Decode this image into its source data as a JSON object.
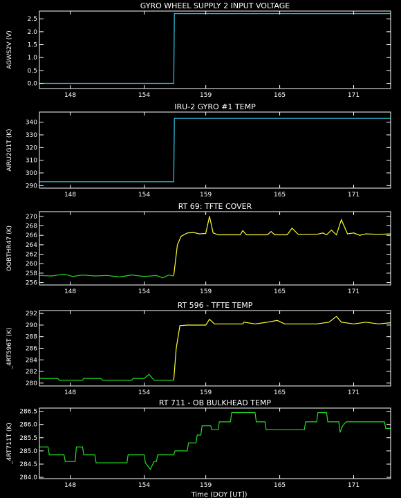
{
  "xlabel": "Time (DOY [UT])",
  "colors": {
    "background": "#000000",
    "axes": "#ffffff",
    "cyan": "#33ccee",
    "yellow": "#ffff33",
    "green": "#22dd22"
  },
  "chart_data": [
    {
      "type": "line",
      "title": "GYRO WHEEL SUPPLY 2 INPUT VOLTAGE",
      "ylabel": "AGWS2V (V)",
      "xlim": [
        145.5,
        174
      ],
      "ylim": [
        -0.2,
        2.8
      ],
      "xticks": [
        148,
        154,
        159,
        165,
        171
      ],
      "xtick_labels": [
        "148",
        "154",
        "159",
        "165",
        "171"
      ],
      "yticks": [
        0.0,
        0.5,
        1.0,
        1.5,
        2.0,
        2.5
      ],
      "ytick_labels": [
        "0.0",
        "0.5",
        "1.0",
        "1.5",
        "2.0",
        "2.5"
      ],
      "series": [
        {
          "color": "cyan",
          "points": [
            [
              145.5,
              0.0
            ],
            [
              156.4,
              0.0
            ],
            [
              156.45,
              2.7
            ],
            [
              174,
              2.7
            ]
          ]
        }
      ]
    },
    {
      "type": "line",
      "title": "IRU-2 GYRO #1 TEMP",
      "ylabel": "AIRU2G1T (K)",
      "xlim": [
        145.5,
        174
      ],
      "ylim": [
        288,
        348
      ],
      "xticks": [
        148,
        154,
        159,
        165,
        171
      ],
      "xtick_labels": [
        "148",
        "154",
        "159",
        "165",
        "171"
      ],
      "yticks": [
        290,
        300,
        310,
        320,
        330,
        340
      ],
      "ytick_labels": [
        "290",
        "300",
        "310",
        "320",
        "330",
        "340"
      ],
      "series": [
        {
          "color": "cyan",
          "points": [
            [
              145.5,
              293
            ],
            [
              156.4,
              293
            ],
            [
              156.45,
              343
            ],
            [
              174,
              343
            ]
          ]
        }
      ]
    },
    {
      "type": "line",
      "title": "RT 69: TFTE COVER",
      "ylabel": "OOBTHR47 (K)",
      "xlim": [
        145.5,
        174
      ],
      "ylim": [
        255.5,
        271
      ],
      "xticks": [
        148,
        154,
        159,
        165,
        171
      ],
      "xtick_labels": [
        "148",
        "154",
        "159",
        "165",
        "171"
      ],
      "yticks": [
        256,
        258,
        260,
        262,
        264,
        266,
        268,
        270
      ],
      "ytick_labels": [
        "256",
        "258",
        "260",
        "262",
        "264",
        "266",
        "268",
        "270"
      ],
      "series": [
        {
          "color": "green",
          "points": [
            [
              145.5,
              257.5
            ],
            [
              146.5,
              257.4
            ],
            [
              147.5,
              257.8
            ],
            [
              148.2,
              257.3
            ],
            [
              149,
              257.6
            ],
            [
              150,
              257.4
            ],
            [
              151,
              257.5
            ],
            [
              152,
              257.2
            ],
            [
              153,
              257.6
            ],
            [
              154,
              257.3
            ],
            [
              155,
              257.5
            ],
            [
              155.5,
              257.0
            ],
            [
              156,
              257.6
            ],
            [
              156.4,
              257.4
            ]
          ]
        },
        {
          "color": "yellow",
          "points": [
            [
              156.4,
              257.5
            ],
            [
              156.7,
              264
            ],
            [
              157,
              265.8
            ],
            [
              157.5,
              266.5
            ],
            [
              158,
              266.6
            ],
            [
              158.5,
              266.3
            ],
            [
              159,
              266.4
            ],
            [
              159.3,
              270.0
            ],
            [
              159.6,
              266.5
            ],
            [
              160,
              266.1
            ],
            [
              161,
              266.1
            ],
            [
              161.8,
              266.1
            ],
            [
              162,
              267.0
            ],
            [
              162.3,
              266.1
            ],
            [
              163,
              266.1
            ],
            [
              164,
              266.1
            ],
            [
              164.3,
              266.8
            ],
            [
              164.6,
              266.1
            ],
            [
              165,
              266.1
            ],
            [
              165.6,
              266.1
            ],
            [
              166,
              267.5
            ],
            [
              166.5,
              266.2
            ],
            [
              167,
              266.2
            ],
            [
              168,
              266.2
            ],
            [
              168.5,
              266.5
            ],
            [
              168.8,
              266.1
            ],
            [
              169.2,
              267.1
            ],
            [
              169.6,
              266.1
            ],
            [
              170,
              269.3
            ],
            [
              170.5,
              266.3
            ],
            [
              171,
              266.5
            ],
            [
              171.5,
              266.0
            ],
            [
              172,
              266.3
            ],
            [
              173,
              266.2
            ],
            [
              174,
              266.3
            ]
          ]
        }
      ]
    },
    {
      "type": "line",
      "title": "RT 596 - TFTE TEMP",
      "ylabel": "_4RT596T (K)",
      "xlim": [
        145.5,
        174
      ],
      "ylim": [
        279.5,
        292.5
      ],
      "xticks": [
        148,
        154,
        159,
        165,
        171
      ],
      "xtick_labels": [
        "148",
        "154",
        "159",
        "165",
        "171"
      ],
      "yticks": [
        280,
        282,
        284,
        286,
        288,
        290,
        292
      ],
      "ytick_labels": [
        "280",
        "282",
        "284",
        "286",
        "288",
        "290",
        "292"
      ],
      "series": [
        {
          "color": "green",
          "points": [
            [
              145.5,
              280.8
            ],
            [
              147,
              280.8
            ],
            [
              147.1,
              280.5
            ],
            [
              149,
              280.5
            ],
            [
              149.1,
              280.8
            ],
            [
              150.5,
              280.8
            ],
            [
              150.6,
              280.5
            ],
            [
              153,
              280.5
            ],
            [
              153.1,
              280.8
            ],
            [
              154,
              280.8
            ],
            [
              154.4,
              281.5
            ],
            [
              154.8,
              280.5
            ],
            [
              156.4,
              280.5
            ]
          ]
        },
        {
          "color": "yellow",
          "points": [
            [
              156.4,
              280.5
            ],
            [
              156.6,
              286
            ],
            [
              156.9,
              289.9
            ],
            [
              157.5,
              290.0
            ],
            [
              158.5,
              290.0
            ],
            [
              159,
              290.0
            ],
            [
              159.3,
              291.0
            ],
            [
              159.7,
              290.2
            ],
            [
              161,
              290.2
            ],
            [
              162,
              290.2
            ],
            [
              162.1,
              290.5
            ],
            [
              163,
              290.2
            ],
            [
              164,
              290.5
            ],
            [
              164.8,
              290.8
            ],
            [
              165.4,
              290.2
            ],
            [
              166,
              290.2
            ],
            [
              168,
              290.2
            ],
            [
              169,
              290.5
            ],
            [
              169.6,
              291.5
            ],
            [
              170,
              290.5
            ],
            [
              171,
              290.2
            ],
            [
              172,
              290.5
            ],
            [
              173,
              290.2
            ],
            [
              174,
              290.4
            ]
          ]
        }
      ]
    },
    {
      "type": "line",
      "title": "RT 711 - OB BULKHEAD TEMP",
      "ylabel": "_4RT711T (K)",
      "xlim": [
        145.5,
        174
      ],
      "ylim": [
        283.95,
        286.62
      ],
      "xticks": [
        148,
        154,
        159,
        165,
        171
      ],
      "xtick_labels": [
        "148",
        "154",
        "159",
        "165",
        "171"
      ],
      "yticks": [
        284.0,
        284.5,
        285.0,
        285.5,
        286.0,
        286.5
      ],
      "ytick_labels": [
        "284.0",
        "284.5",
        "285.0",
        "285.5",
        "286.0",
        "286.5"
      ],
      "series": [
        {
          "color": "green",
          "points": [
            [
              145.5,
              285.15
            ],
            [
              146.2,
              285.15
            ],
            [
              146.3,
              284.85
            ],
            [
              147.5,
              284.85
            ],
            [
              147.6,
              284.6
            ],
            [
              148.4,
              284.6
            ],
            [
              148.5,
              285.15
            ],
            [
              149,
              285.15
            ],
            [
              149.1,
              284.85
            ],
            [
              150,
              284.85
            ],
            [
              150.1,
              284.55
            ],
            [
              152.6,
              284.55
            ],
            [
              152.7,
              284.85
            ],
            [
              154,
              284.85
            ],
            [
              154.1,
              284.55
            ],
            [
              154.5,
              284.3
            ],
            [
              154.8,
              284.6
            ],
            [
              155,
              284.6
            ],
            [
              155.1,
              284.85
            ],
            [
              156.4,
              284.85
            ],
            [
              156.5,
              285.0
            ],
            [
              157.5,
              285.0
            ],
            [
              157.6,
              285.3
            ],
            [
              158.2,
              285.3
            ],
            [
              158.3,
              285.6
            ],
            [
              158.6,
              285.6
            ],
            [
              158.7,
              285.95
            ],
            [
              159.4,
              285.95
            ],
            [
              159.5,
              285.8
            ],
            [
              160,
              285.8
            ],
            [
              160.1,
              286.1
            ],
            [
              161,
              286.1
            ],
            [
              161.1,
              286.45
            ],
            [
              163,
              286.45
            ],
            [
              163.1,
              286.1
            ],
            [
              163.8,
              286.1
            ],
            [
              163.9,
              285.8
            ],
            [
              167,
              285.8
            ],
            [
              167.1,
              286.1
            ],
            [
              168,
              286.1
            ],
            [
              168.1,
              286.45
            ],
            [
              168.8,
              286.45
            ],
            [
              168.9,
              286.1
            ],
            [
              169.8,
              286.1
            ],
            [
              169.9,
              285.7
            ],
            [
              170.1,
              285.95
            ],
            [
              170.4,
              286.1
            ],
            [
              173.5,
              286.1
            ],
            [
              173.6,
              285.85
            ],
            [
              174,
              285.85
            ]
          ]
        }
      ]
    }
  ]
}
